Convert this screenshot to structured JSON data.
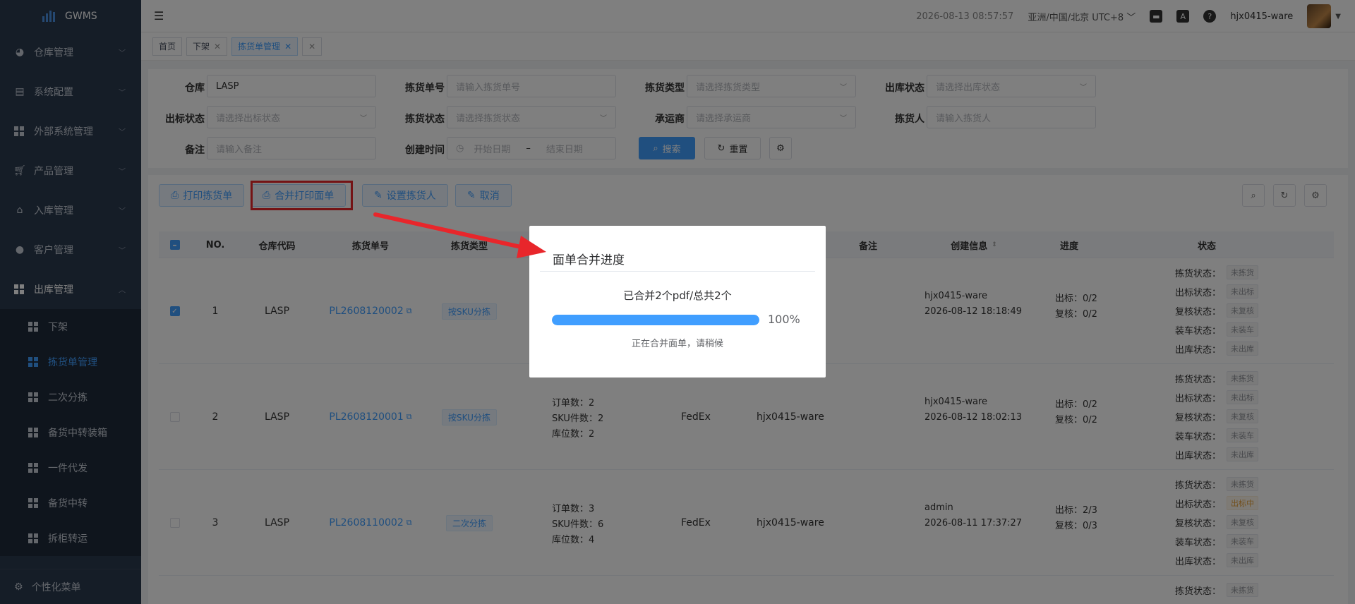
{
  "app": {
    "brand": "GWMS"
  },
  "sidebar": {
    "items": [
      {
        "label": "仓库管理"
      },
      {
        "label": "系统配置"
      },
      {
        "label": "外部系统管理"
      },
      {
        "label": "产品管理"
      },
      {
        "label": "入库管理"
      },
      {
        "label": "客户管理"
      },
      {
        "label": "出库管理"
      }
    ],
    "sub_items": [
      {
        "label": "下架"
      },
      {
        "label": "拣货单管理"
      },
      {
        "label": "二次分拣"
      },
      {
        "label": "备货中转装箱"
      },
      {
        "label": "一件代发"
      },
      {
        "label": "备货中转"
      },
      {
        "label": "拆柜转运"
      }
    ],
    "footer_label": "个性化菜单"
  },
  "header": {
    "datetime": "2026-08-13 08:57:57",
    "timezone": "亚洲/中国/北京 UTC+8",
    "username": "hjx0415-ware"
  },
  "tabs": [
    {
      "label": "首页"
    },
    {
      "label": "下架"
    },
    {
      "label": "拣货单管理"
    }
  ],
  "filter": {
    "warehouse_label": "仓库",
    "warehouse_value": "LASP",
    "pick_no_label": "拣货单号",
    "pick_no_placeholder": "请输入拣货单号",
    "pick_type_label": "拣货类型",
    "pick_type_placeholder": "请选择拣货类型",
    "out_status_label": "出库状态",
    "out_status_placeholder": "请选择出库状态",
    "label_status_label": "出标状态",
    "label_status_placeholder": "请选择出标状态",
    "pick_status_label": "拣货状态",
    "pick_status_placeholder": "请选择拣货状态",
    "carrier_label": "承运商",
    "carrier_placeholder": "请选择承运商",
    "picker_label": "拣货人",
    "picker_placeholder": "请输入拣货人",
    "remark_label": "备注",
    "remark_placeholder": "请输入备注",
    "created_label": "创建时间",
    "start_placeholder": "开始日期",
    "date_sep": "–",
    "end_placeholder": "结束日期",
    "search_label": "搜索",
    "reset_label": "重置"
  },
  "toolbar": {
    "print_pick": "打印拣货单",
    "merge_print": "合并打印面单",
    "set_picker": "设置拣货人",
    "cancel": "取消"
  },
  "table": {
    "headers": {
      "no": "NO.",
      "warehouse": "仓库代码",
      "pick_no": "拣货单号",
      "pick_type": "拣货类型",
      "remark": "备注",
      "created": "创建信息",
      "progress": "进度",
      "status": "状态"
    },
    "rows": [
      {
        "no": "1",
        "warehouse": "LASP",
        "pick_no": "PL2608120002",
        "type": "按SKU分拣",
        "order_cnt": "",
        "sku_cnt": "",
        "loc_cnt": "",
        "carrier": "",
        "picker": "",
        "creator": "hjx0415-ware",
        "created_at": "2026-08-12 18:18:49",
        "label_prog": "出标：0/2",
        "check_prog": "复核：0/2",
        "statuses": [
          {
            "k": "拣货状态：",
            "v": "未拣货"
          },
          {
            "k": "出标状态：",
            "v": "未出标"
          },
          {
            "k": "复核状态：",
            "v": "未复核"
          },
          {
            "k": "装车状态：",
            "v": "未装车"
          },
          {
            "k": "出库状态：",
            "v": "未出库"
          }
        ]
      },
      {
        "no": "2",
        "warehouse": "LASP",
        "pick_no": "PL2608120001",
        "type": "按SKU分拣",
        "order_cnt": "订单数：2",
        "sku_cnt": "SKU件数：2",
        "loc_cnt": "库位数：2",
        "carrier": "FedEx",
        "picker": "hjx0415-ware",
        "creator": "hjx0415-ware",
        "created_at": "2026-08-12 18:02:13",
        "label_prog": "出标：0/2",
        "check_prog": "复核：0/2",
        "statuses": [
          {
            "k": "拣货状态：",
            "v": "未拣货"
          },
          {
            "k": "出标状态：",
            "v": "未出标"
          },
          {
            "k": "复核状态：",
            "v": "未复核"
          },
          {
            "k": "装车状态：",
            "v": "未装车"
          },
          {
            "k": "出库状态：",
            "v": "未出库"
          }
        ]
      },
      {
        "no": "3",
        "warehouse": "LASP",
        "pick_no": "PL2608110002",
        "type": "二次分拣",
        "order_cnt": "订单数：3",
        "sku_cnt": "SKU件数：6",
        "loc_cnt": "库位数：4",
        "carrier": "FedEx",
        "picker": "hjx0415-ware",
        "creator": "admin",
        "created_at": "2026-08-11 17:37:27",
        "label_prog": "出标：2/3",
        "check_prog": "复核：0/3",
        "statuses": [
          {
            "k": "拣货状态：",
            "v": "未拣货"
          },
          {
            "k": "出标状态：",
            "v": "出标中"
          },
          {
            "k": "复核状态：",
            "v": "未复核"
          },
          {
            "k": "装车状态：",
            "v": "未装车"
          },
          {
            "k": "出库状态：",
            "v": "未出库"
          }
        ]
      }
    ],
    "row4_first_status": {
      "k": "拣货状态：",
      "v": "未拣货"
    }
  },
  "modal": {
    "title": "面单合并进度",
    "message": "已合并2个pdf/总共2个",
    "percent_text": "100%",
    "progress": 1.0,
    "sub": "正在合并面单，请稍候"
  },
  "colors": {
    "accent": "#409eff",
    "highlight": "#e8262b",
    "sidebar": "#2b3a4f"
  }
}
